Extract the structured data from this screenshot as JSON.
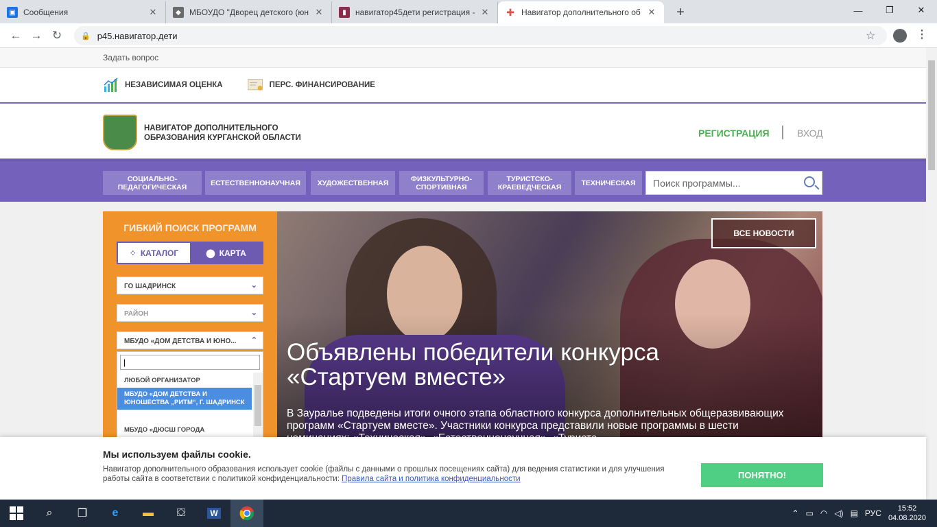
{
  "browser": {
    "tabs": [
      {
        "title": "Сообщения",
        "color": "#1a73e8",
        "glyph": "▣"
      },
      {
        "title": "МБОУДО \"Дворец детского (юн",
        "color": "#6b6b6b",
        "glyph": "◆"
      },
      {
        "title": "навигатор45дети регистрация -",
        "color": "#8e2a4a",
        "glyph": "▮"
      },
      {
        "title": "Навигатор дополнительного об",
        "color": "#e0524c",
        "glyph": "✚"
      }
    ],
    "new_tab": "+",
    "url": "р45.навигатор.дети"
  },
  "site": {
    "ask": "Задать вопрос",
    "topnav": [
      {
        "label": "НЕЗАВИСИМАЯ ОЦЕНКА",
        "icon": "chart-icon"
      },
      {
        "label": "ПЕРС. ФИНАНСИРОВАНИЕ",
        "icon": "certificate-icon"
      }
    ],
    "brand": {
      "line1": "НАВИГАТОР ДОПОЛНИТЕЛЬНОГО",
      "line2": "ОБРАЗОВАНИЯ КУРГАНСКОЙ ОБЛАСТИ"
    },
    "register": "РЕГИСТРАЦИЯ",
    "login": "ВХОД",
    "categories": [
      {
        "l1": "СОЦИАЛЬНО-",
        "l2": "ПЕДАГОГИЧЕСКАЯ"
      },
      {
        "l1": "ЕСТЕСТВЕННОНАУЧНАЯ",
        "l2": ""
      },
      {
        "l1": "ХУДОЖЕСТВЕННАЯ",
        "l2": ""
      },
      {
        "l1": "ФИЗКУЛЬТУРНО-",
        "l2": "СПОРТИВНАЯ"
      },
      {
        "l1": "ТУРИСТСКО-",
        "l2": "КРАЕВЕДЧЕСКАЯ"
      },
      {
        "l1": "ТЕХНИЧЕСКАЯ",
        "l2": ""
      }
    ],
    "search_placeholder": "Поиск программы...",
    "filter": {
      "title": "ГИБКИЙ ПОИСК ПРОГРАММ",
      "catalog": "КАТАЛОГ",
      "map": "КАРТА",
      "municipality": "ГО ШАДРИНСК",
      "district": "РАЙОН",
      "organizer": "МБУДО «ДОМ ДЕТСТВА И ЮНО...",
      "dd_value": "|",
      "options": [
        "ЛЮБОЙ ОРГАНИЗАТОР",
        "МБУДО «ДОМ ДЕТСТВА И ЮНОШЕСТВА „РИТМ“, Г. ШАДРИНСК",
        "МБУДО «ДЮСШ ГОРОДА"
      ]
    },
    "banner": {
      "all_news": "ВСЕ НОВОСТИ",
      "headline": "Объявлены победители конкурса «Стартуем вместе»",
      "lead": "В Зауралье подведены итоги очного этапа областного конкурса дополнительных общеразвивающих программ «Стартуем вместе». Участники конкурса представили новые программы в шести номинациях: «Техническая», «Естественнонаучная», «Туристс"
    },
    "cookie": {
      "title": "Мы используем файлы cookie.",
      "text": "Навигатор дополнительного образования использует cookie (файлы с данными о прошлых посещениях сайта) для ведения статистики и для улучшения работы сайта в соответствии с политикой конфиденциальности:",
      "link": "Правила сайта и политика конфиденциальности",
      "button": "ПОНЯТНО!"
    }
  },
  "taskbar": {
    "lang": "РУС",
    "time": "15:52",
    "date": "04.08.2020"
  }
}
